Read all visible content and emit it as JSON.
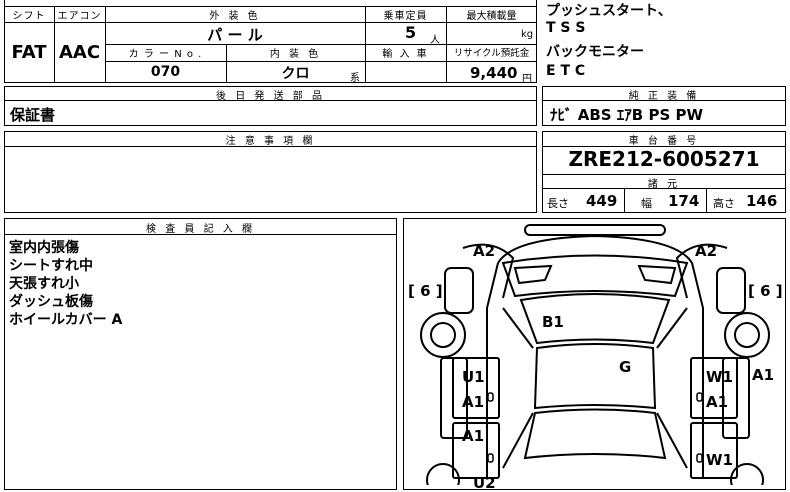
{
  "spec": {
    "shift_header": "シフト",
    "ac_header": "エアコン",
    "shift_value": "FAT",
    "ac_value": "AAC",
    "exterior_color_header": "外 装 色",
    "exterior_color_value": "パ ー ル",
    "capacity_header": "乗車定員",
    "capacity_value": "5",
    "capacity_unit": "人",
    "max_load_header": "最大積載量",
    "max_load_unit": "kg",
    "color_no_header": "カ ラ ー N o .",
    "color_no_value": "070",
    "interior_color_header": "内 装 色",
    "interior_color_value": "クロ",
    "interior_suffix": "系",
    "import_header": "輸 入 車",
    "recycle_header": "リサイクル預託金",
    "recycle_value": "9,440",
    "recycle_unit": "円"
  },
  "later_parts": {
    "header": "後 日 発 送 部 品",
    "value": "保証書"
  },
  "options_text": [
    "プッシュスタート、",
    "T S S",
    "バックモニター",
    "E T C"
  ],
  "genuine": {
    "header": "純 正 装 備",
    "value": "ﾅﾋﾞ ABS ｴｱB PS PW"
  },
  "notes": {
    "header": "注 意 事 項 欄"
  },
  "chassis": {
    "header": "車 台 番 号",
    "value": "ZRE212-6005271",
    "dims_header": "諸 元",
    "length_label": "長さ",
    "length_value": "449",
    "width_label": "幅",
    "width_value": "174",
    "height_label": "高さ",
    "height_value": "146"
  },
  "inspector": {
    "header": "検 査 員 記 入 欄",
    "lines": [
      "室内内張傷",
      "シートすれ中",
      "天張すれ小",
      "ダッシュ板傷",
      "ホイールカバー A"
    ]
  },
  "diagram": {
    "left_bracket": "[ 6 ]",
    "right_bracket": "[ 6 ]",
    "marks": {
      "a2_left": "A2",
      "a2_right": "A2",
      "b1": "B1",
      "g": "G",
      "u1": "U1",
      "a1_left_front": "A1",
      "a1_left_rear": "A1",
      "w1_right_front": "W1",
      "a1_right_front": "A1",
      "a1_far_right": "A1",
      "w1_right_rear": "W1",
      "u2": "U2"
    }
  }
}
